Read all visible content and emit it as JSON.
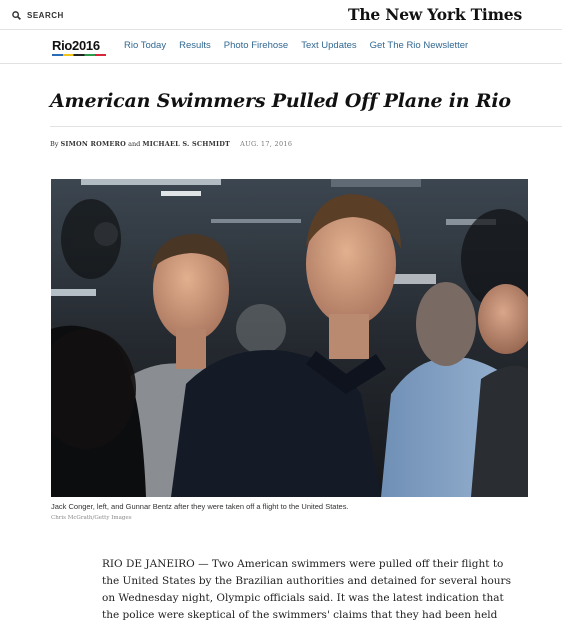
{
  "masthead": {
    "search_label": "SEARCH",
    "logo": "The New York Times"
  },
  "section_nav": {
    "logo": "Rio2016",
    "links": [
      "Rio Today",
      "Results",
      "Photo Firehose",
      "Text Updates",
      "Get The Rio Newsletter"
    ]
  },
  "article": {
    "headline": "American Swimmers Pulled Off Plane in Rio",
    "byline_prefix": "By",
    "author_1": "SIMON ROMERO",
    "byline_and": "and",
    "author_2": "MICHAEL S. SCHMIDT",
    "date": "AUG. 17, 2016",
    "caption": "Jack Conger, left, and Gunnar Bentz after they were taken off a flight to the United States.",
    "credit": "Chris McGrath/Getty Images",
    "body_lines": [
      "RIO DE JANEIRO — Two American swimmers were pulled off their flight to",
      "the United States by the Brazilian authorities and detained for several hours",
      "on Wednesday night, Olympic officials said. It was the latest indication that",
      "the police were skeptical of the swimmers' claims that they had been held"
    ]
  }
}
